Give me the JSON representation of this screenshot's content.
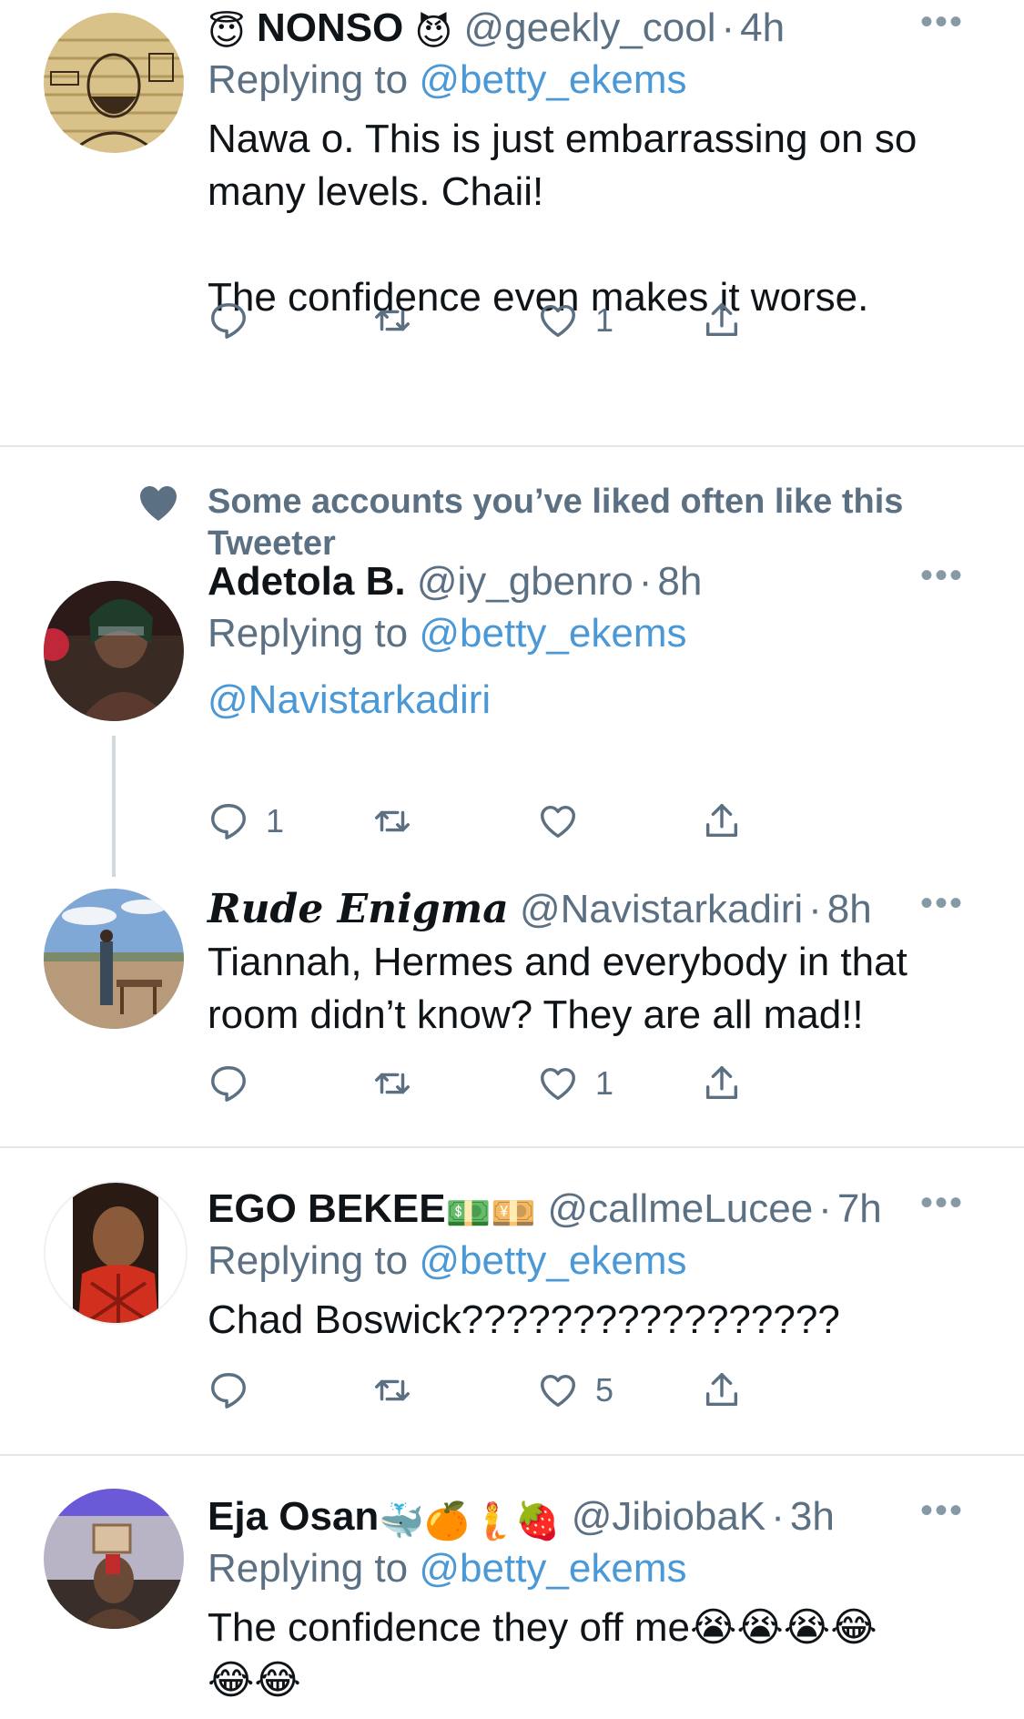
{
  "tweets": [
    {
      "name": "NONSO",
      "name_prefix_emoji": "😇",
      "name_suffix_emoji": "😈",
      "handle": "@geekly_cool",
      "time": "4h",
      "replying_label": "Replying to",
      "replying_to": "@betty_ekems",
      "body_lines": [
        "Nawa o. This is just embarrassing on so",
        "many levels. Chaii!",
        "",
        "The confidence even makes it worse."
      ],
      "reply_count": "",
      "retweet_count": "",
      "like_count": "1"
    },
    {
      "social_context": "Some accounts you’ve liked often like this Tweeter",
      "name": "Adetola B.",
      "handle": "@iy_gbenro",
      "time": "8h",
      "replying_label": "Replying to",
      "replying_to": "@betty_ekems",
      "body_mention": "@Navistarkadiri",
      "reply_count": "1",
      "retweet_count": "",
      "like_count": ""
    },
    {
      "name": "Rude Enigma",
      "handle": "@Navistarkadiri",
      "time": "8h",
      "body_lines": [
        "Tiannah, Hermes and everybody in that",
        "room didn’t know? They are all mad!!"
      ],
      "reply_count": "",
      "retweet_count": "",
      "like_count": "1"
    },
    {
      "name": "EGO BEKEE",
      "name_suffix_emoji": "💵💴",
      "handle": "@callmeLucee",
      "time": "7h",
      "replying_label": "Replying to",
      "replying_to": "@betty_ekems",
      "body_lines": [
        "Chad Boswick?????????????????"
      ],
      "reply_count": "",
      "retweet_count": "",
      "like_count": "5"
    },
    {
      "name": "Eja Osan",
      "name_suffix_emoji": "🐳🍊🧜🍓",
      "handle": "@JibiobaK",
      "time": "3h",
      "replying_label": "Replying to",
      "replying_to": "@betty_ekems",
      "body_lines": [
        "The confidence they off me😭😭😭😂",
        "😂😂"
      ]
    }
  ],
  "icons": {
    "reply": "reply-icon",
    "retweet": "retweet-icon",
    "like": "heart-icon",
    "share": "share-icon",
    "more": "more-icon",
    "social_heart": "heart-filled-icon"
  },
  "more_glyph": "•••",
  "colors": {
    "link": "#4a99d6",
    "secondary": "#5b7083",
    "divider": "#e3e7ea"
  }
}
